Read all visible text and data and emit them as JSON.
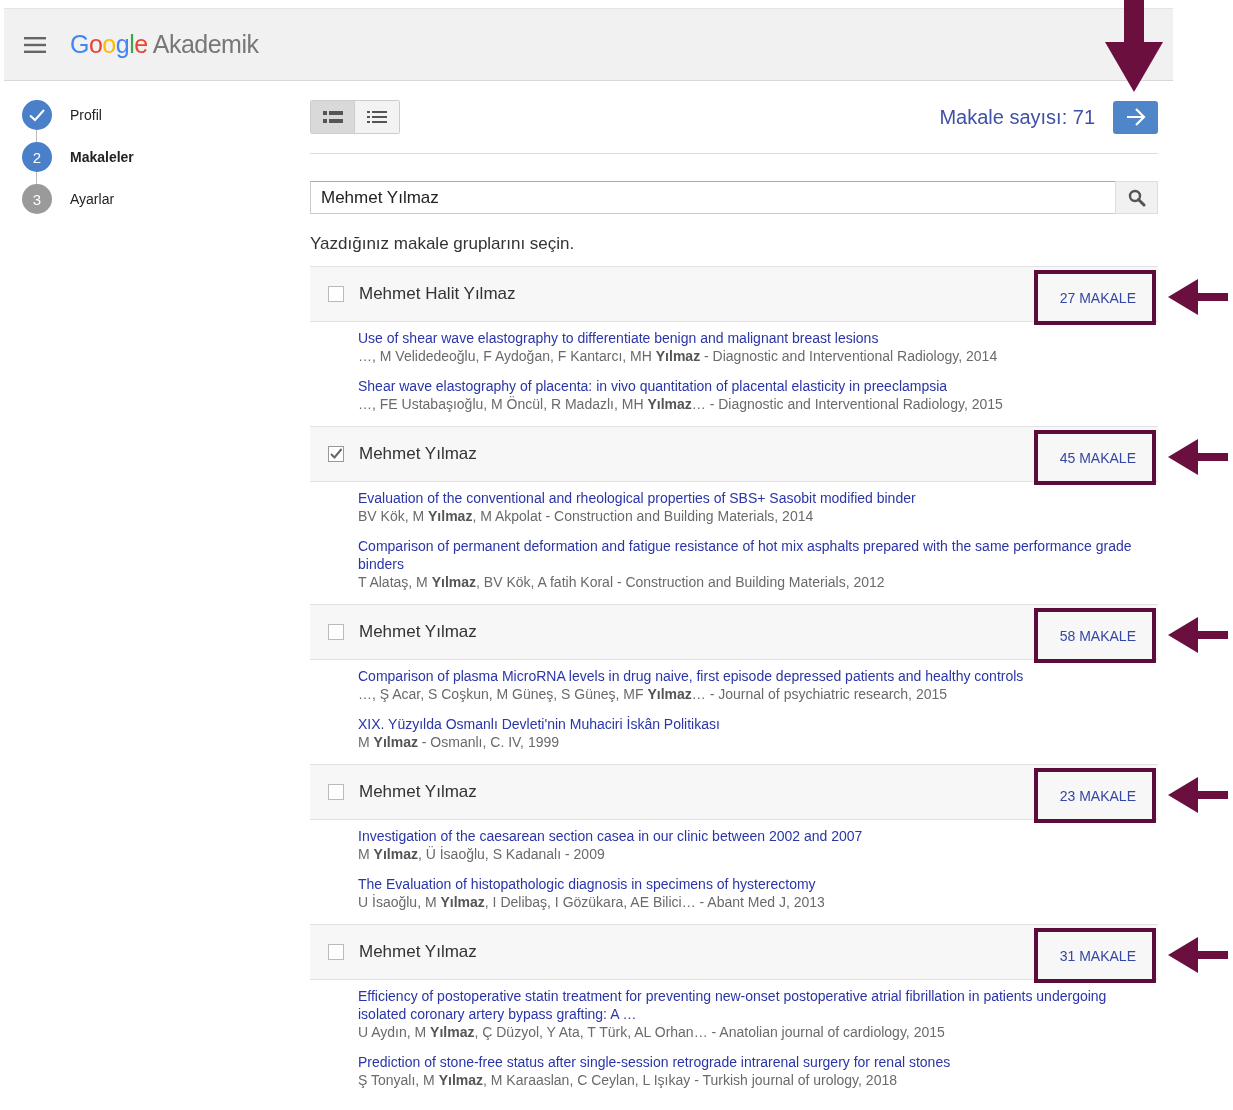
{
  "header": {
    "logo_brand": "Google",
    "logo_product": "Akademik"
  },
  "steps": [
    {
      "label": "Profil",
      "completed": true,
      "selected": false
    },
    {
      "number": "2",
      "label": "Makaleler",
      "completed": false,
      "selected": true
    },
    {
      "number": "3",
      "label": "Ayarlar",
      "completed": false,
      "selected": false
    }
  ],
  "view_toggle": [
    {
      "kind": "detailed",
      "selected": true
    },
    {
      "kind": "compact",
      "selected": false
    }
  ],
  "article_count": "Makale sayısı: 71",
  "next_button": {
    "highlighted": true
  },
  "search": {
    "value": "Mehmet Yılmaz"
  },
  "prompt": "Yazdığınız makale gruplarını seçin.",
  "groups": [
    {
      "name": "Mehmet Halit Yılmaz",
      "checked": false,
      "count": "27 MAKALE",
      "highlighted": true,
      "articles": [
        {
          "title": "Use of shear wave elastography to differentiate benign and malignant breast lesions",
          "authors": "…, M Velidedeoğlu, F Aydoğan, F Kantarcı, MH **Yılmaz** - Diagnostic and Interventional Radiology, 2014"
        },
        {
          "title": "Shear wave elastography of placenta: in vivo quantitation of placental elasticity in preeclampsia",
          "authors": "…, FE Ustabaşıoğlu, M Öncül, R Madazlı, MH **Yılmaz**… - Diagnostic and Interventional Radiology, 2015"
        }
      ]
    },
    {
      "name": "Mehmet Yılmaz",
      "checked": true,
      "count": "45 MAKALE",
      "highlighted": true,
      "articles": [
        {
          "title": "Evaluation of the conventional and rheological properties of SBS+ Sasobit modified binder",
          "authors": "BV Kök, M **Yılmaz**, M Akpolat - Construction and Building Materials, 2014"
        },
        {
          "title": "Comparison of permanent deformation and fatigue resistance of hot mix asphalts prepared with the same performance grade binders",
          "authors": "T Alataş, M **Yılmaz**, BV Kök, A fatih Koral - Construction and Building Materials, 2012"
        }
      ]
    },
    {
      "name": "Mehmet Yılmaz",
      "checked": false,
      "count": "58 MAKALE",
      "highlighted": true,
      "articles": [
        {
          "title": "Comparison of plasma MicroRNA levels in drug naive, first episode depressed patients and healthy controls",
          "authors": "…, Ş Acar, S Coşkun, M Güneş, S Güneş, MF **Yılmaz**… - Journal of psychiatric research, 2015"
        },
        {
          "title": "XIX. Yüzyılda Osmanlı Devleti'nin Muhaciri İskân Politikası",
          "authors": "M **Yılmaz** - Osmanlı, C. IV, 1999"
        }
      ]
    },
    {
      "name": "Mehmet Yılmaz",
      "checked": false,
      "count": "23 MAKALE",
      "highlighted": true,
      "articles": [
        {
          "title": "Investigation of the caesarean section casea in our clinic between 2002 and 2007",
          "authors": "M **Yılmaz**, Ü İsaoğlu, S Kadanalı - 2009"
        },
        {
          "title": "The Evaluation of histopathologic diagnosis in specimens of hysterectomy",
          "authors": "U İsaoğlu, M **Yılmaz**, I Delibaş, I Gözükara, AE Bilici… - Abant Med J, 2013"
        }
      ]
    },
    {
      "name": "Mehmet Yılmaz",
      "checked": false,
      "count": "31 MAKALE",
      "highlighted": true,
      "articles": [
        {
          "title": "Efficiency of postoperative statin treatment for preventing new-onset postoperative atrial fibrillation in patients undergoing isolated coronary artery bypass grafting: A …",
          "authors": "U Aydın, M **Yılmaz**, Ç Düzyol, Y Ata, T Türk, AL Orhan… - Anatolian journal of cardiology, 2015"
        },
        {
          "title": "Prediction of stone-free status after single-session retrograde intrarenal surgery for renal stones",
          "authors": "Ş Tonyalı, M **Yılmaz**, M Karaaslan, C Ceylan, L Işıkay - Turkish journal of urology, 2018"
        }
      ]
    }
  ]
}
